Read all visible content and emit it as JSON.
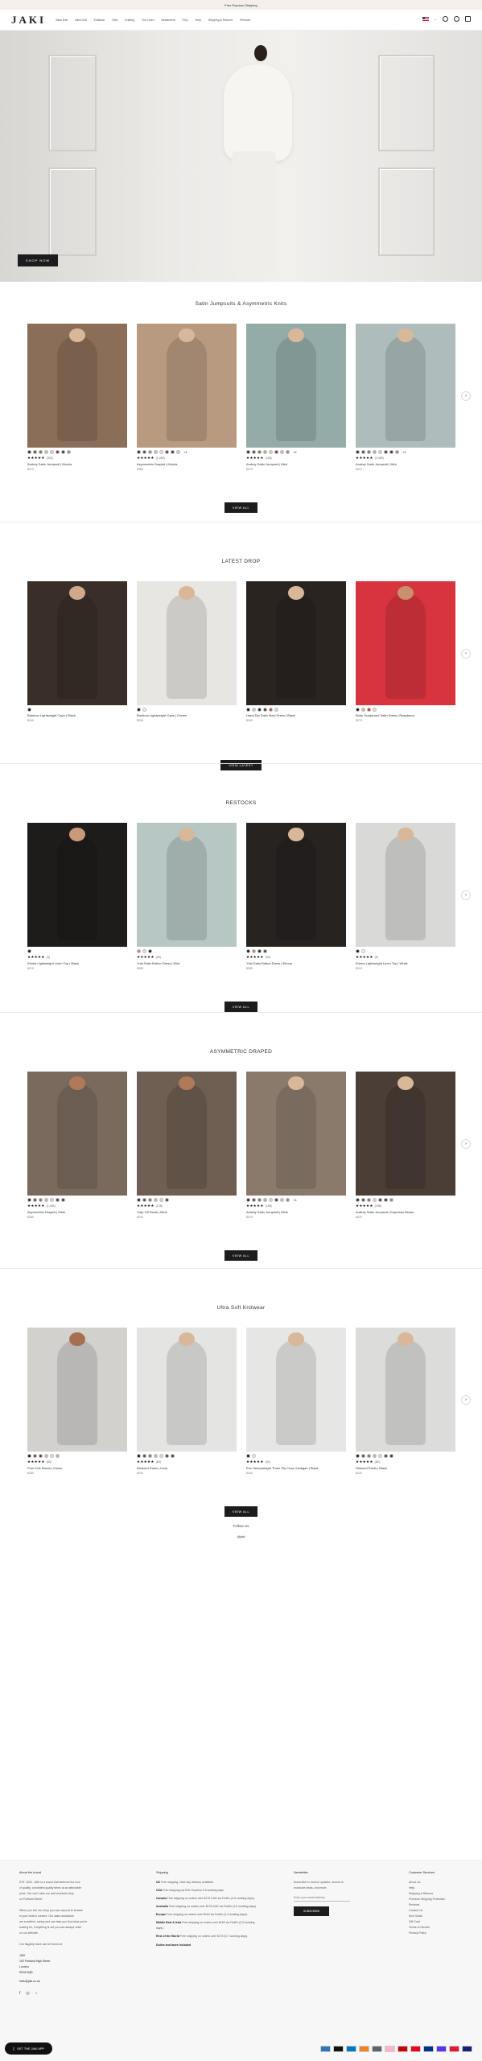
{
  "announcement": "Free Express Shipping",
  "header": {
    "logo": "JAKI",
    "nav": [
      "Satin Edit",
      "Ultra Soft",
      "Knitwear",
      "Sets",
      "Knitting",
      "The Linen",
      "Bestsellers",
      "FAQ",
      "Help",
      "Shipping & Returns",
      "Reviews"
    ],
    "flag": "US",
    "icons": [
      "account-icon",
      "search-icon",
      "bag-icon"
    ]
  },
  "hero": {
    "button_label": "SHOP NOW"
  },
  "sections": [
    {
      "title": "Satin Jumpsuits & Asymmetric Knits",
      "button_label": "VIEW ALL",
      "products": [
        {
          "name": "Audrey Satin Jumpsuit | Mocha",
          "price": "$379",
          "stars": "★★★★★",
          "reviews": "(332)",
          "swatches": [
            "#2b2b2b",
            "#6b4a3a",
            "#8a6f5c",
            "#c9b7a3",
            "#ddd2c4",
            "#7b2a3b",
            "#3a3a3a",
            "#9a8a7a"
          ],
          "more": "",
          "img": "#8a6e58",
          "skin": "#d9b89a"
        },
        {
          "name": "Asymmetric Draped | Mocha",
          "price": "$385",
          "stars": "★★★★★",
          "reviews": "(1,469)",
          "swatches": [
            "#2b2b2b",
            "#6b4a3a",
            "#a58f7b",
            "#c9c3bb",
            "#e6e0d6",
            "#7b2a3b",
            "#3a3a3a",
            "#d4c9bb"
          ],
          "more": "+4",
          "img": "#b89a80",
          "skin": "#d9b89a"
        },
        {
          "name": "Audrey Satin Jumpsuit | Mint",
          "price": "$379",
          "stars": "★★★★★",
          "reviews": "(158)",
          "swatches": [
            "#2b2b2b",
            "#6b4a3a",
            "#8a6f5c",
            "#9bb3ad",
            "#ddd2c4",
            "#7b2a3b",
            "#c3c3c3",
            "#9a8a7a"
          ],
          "more": "+4",
          "img": "#93aca8",
          "skin": "#d9b89a"
        },
        {
          "name": "Audrey Satin Jumpsuit | Mint",
          "price": "$379",
          "stars": "★★★★★",
          "reviews": "(1,469)",
          "swatches": [
            "#2b2b2b",
            "#6b4a3a",
            "#8a6f5c",
            "#9bb3ad",
            "#ddd2c4",
            "#7b2a3b",
            "#3a3a3a",
            "#9a8a7a"
          ],
          "more": "+4",
          "img": "#aebcbc",
          "skin": "#d9b89a"
        }
      ]
    },
    {
      "title": "LATEST DROP",
      "button_label": "VIEW LATEST",
      "products": [
        {
          "name": "Bamboo Lightweight Cape | Black",
          "price": "$249",
          "stars": "",
          "reviews": "",
          "swatches": [
            "#1a1a1a"
          ],
          "more": "",
          "img": "#3a2e28",
          "skin": "#d0a98d"
        },
        {
          "name": "Bamboo Lightweight Cape | Cream",
          "price": "$249",
          "stars": "",
          "reviews": "",
          "swatches": [
            "#1a1a1a",
            "#f2efe9"
          ],
          "more": "",
          "img": "#e8e6e2",
          "skin": "#d9b89a"
        },
        {
          "name": "Hand Dip Satin Maxi Dress | Black",
          "price": "$299",
          "stars": "",
          "reviews": "",
          "swatches": [
            "#1a1a1a",
            "#e3c8b8",
            "#2a2a2a",
            "#5a3a30",
            "#c14b4b",
            "#d9d2c6"
          ],
          "more": "",
          "img": "#2a2421",
          "skin": "#d9b89a"
        },
        {
          "name": "Body Sculptured Satin Dress | Raspberry",
          "price": "$279",
          "stars": "",
          "reviews": "",
          "swatches": [
            "#1a1a1a",
            "#c9b8a8",
            "#c9323f",
            "#e8ddd2"
          ],
          "more": "",
          "img": "#d7343d",
          "skin": "#c98f6f"
        }
      ]
    },
    {
      "title": "RESTOCKS",
      "button_label": "VIEW ALL",
      "products": [
        {
          "name": "Kimba Lightweight Linen Top | Black",
          "price": "$219",
          "stars": "★★★★★",
          "reviews": "(9)",
          "swatches": [
            "#1a1a1a"
          ],
          "more": "",
          "img": "#1e1c1b",
          "skin": "#c89a7a"
        },
        {
          "name": "Yula Satin Button Dress | Mint",
          "price": "$289",
          "stars": "★★★★★",
          "reviews": "(53)",
          "swatches": [
            "#c9856a",
            "#e5dccf",
            "#1a1a1a"
          ],
          "more": "",
          "img": "#b7c7c3",
          "skin": "#d9b89a"
        },
        {
          "name": "Yula Satin Button Dress | Ebony",
          "price": "$289",
          "stars": "★★★★★",
          "reviews": "(53)",
          "swatches": [
            "#1a1a1a",
            "#c9856a",
            "#2a2a2a",
            "#4a4a4a"
          ],
          "more": "",
          "img": "#262321",
          "skin": "#d9b89a"
        },
        {
          "name": "Emma Lightweight Linen Top | White",
          "price": "$219",
          "stars": "★★★★★",
          "reviews": "(9)",
          "swatches": [
            "#1a1a1a",
            "#f5f5f2"
          ],
          "more": "",
          "img": "#d9d9d7",
          "skin": "#d9b89a"
        }
      ]
    },
    {
      "title": "ASYMMETRIC DRAPED",
      "button_label": "VIEW ALL",
      "products": [
        {
          "name": "Asymmetric Draped | Mink",
          "price": "$385",
          "stars": "★★★★★",
          "reviews": "(1,469)",
          "swatches": [
            "#2b2b2b",
            "#6b4a3a",
            "#8a7566",
            "#c9b7a3",
            "#ddd2c4",
            "#7b2a3b",
            "#3a3a3a"
          ],
          "more": "",
          "img": "#7a6a5e",
          "skin": "#b07a5a"
        },
        {
          "name": "Tulip Oil Pants | Mink",
          "price": "$249",
          "stars": "★★★★★",
          "reviews": "(128)",
          "swatches": [
            "#2b2b2b",
            "#6b4a3a",
            "#8a7566",
            "#c9b7a3",
            "#ddd2c4",
            "#7b2a3b"
          ],
          "more": "",
          "img": "#6f5e52",
          "skin": "#b07a5a"
        },
        {
          "name": "Audrey Satin Jumpsuit | Mink",
          "price": "$379",
          "stars": "★★★★★",
          "reviews": "(158)",
          "swatches": [
            "#2b2b2b",
            "#6b4a3a",
            "#8a7566",
            "#9bb3ad",
            "#ddd2c4",
            "#7b2a3b",
            "#c3c3c3",
            "#9a8a7a"
          ],
          "more": "+4",
          "img": "#8a7a6c",
          "skin": "#d9b89a"
        },
        {
          "name": "Audrey Satin Jumpsuit | Espresso Brown",
          "price": "$379",
          "stars": "★★★★★",
          "reviews": "(158)",
          "swatches": [
            "#2b2b2b",
            "#6b4a3a",
            "#8a6f5c",
            "#ddd2c4",
            "#7b2a3b",
            "#3a3a3a",
            "#9a8a7a"
          ],
          "more": "",
          "img": "#4a3e36",
          "skin": "#d9b89a"
        }
      ]
    },
    {
      "title": "Ultra Soft Knitwear",
      "button_label": "VIEW ALL",
      "products": [
        {
          "name": "Pure Knit Sweat | Cerise",
          "price": "$289",
          "stars": "★★★★★",
          "reviews": "(80)",
          "swatches": [
            "#1a1a1a",
            "#6b4a3a",
            "#7a2a55",
            "#c9b7a3",
            "#e3ddd2",
            "#b2b2b2"
          ],
          "more": "",
          "img": "#d3d1ce",
          "skin": "#a56f50"
        },
        {
          "name": "Relaxed Pants | Ivory",
          "price": "$249",
          "stars": "★★★★★",
          "reviews": "(80)",
          "swatches": [
            "#1a1a1a",
            "#6b4a3a",
            "#8a7566",
            "#c9b7a3",
            "#e3ddd2",
            "#7b2a3b",
            "#2f3a5a"
          ],
          "more": "",
          "img": "#e4e4e2",
          "skin": "#d9b89a"
        },
        {
          "name": "Eve Heavyweight Three Ply Cozy Cardigan | Black",
          "price": "$349",
          "stars": "★★★★★",
          "reviews": "(52)",
          "swatches": [
            "#1a1a1a",
            "#f3f0ea"
          ],
          "more": "",
          "img": "#e6e6e4",
          "skin": "#d9b89a"
        },
        {
          "name": "Relaxed Pants | Black",
          "price": "$249",
          "stars": "★★★★★",
          "reviews": "(80)",
          "swatches": [
            "#1a1a1a",
            "#6b4a3a",
            "#8a7566",
            "#c9b7a3",
            "#e3ddd2",
            "#7b2a3b",
            "#2f3a5a"
          ],
          "more": "",
          "img": "#dcdcda",
          "skin": "#d9b89a"
        }
      ]
    }
  ],
  "follow": {
    "title": "Follow Us",
    "handle": "@jaki"
  },
  "footer": {
    "about": {
      "title": "About the brand",
      "lines": [
        "EST. 2020. JAKI is a brand that believes the love",
        "of quality, consistent quality items at an affordable",
        "price. You can't miss our well-received shop",
        "on Portland Street."
      ],
      "lines2": [
        "When you see our shop you can request to browse",
        "in your heart's content. Our sales assistants",
        "are excellent, caring and can help you find what you're",
        "looking for, if anything is out you can always order",
        "on our website."
      ],
      "lines3": [
        "Our flagship store can be found at:"
      ],
      "address": [
        "JAKI",
        "192 Portland High Street",
        "London",
        "W1W 5QB"
      ],
      "email": "hello@jaki.co.uk",
      "social": [
        "f",
        "◎",
        "♪"
      ]
    },
    "shipping": {
      "title": "Shipping",
      "rows": [
        {
          "label": "UK",
          "text": "Free shipping. Next day delivery available."
        },
        {
          "label": "USA",
          "text": "Free shipping via DHL Express 3-5 working days."
        },
        {
          "label": "Canada",
          "text": "Free shipping on orders over $175 CAD via FedEx (3-5 working days)."
        },
        {
          "label": "Australia",
          "text": "Free shipping on orders over $175 AUD via FedEx (3-5 working days)."
        },
        {
          "label": "Europe",
          "text": "Free shipping on orders over €150 via FedEx (2-4 working days)."
        },
        {
          "label": "Middle East & Asia",
          "text": "Free shipping on orders over $150 via FedEx (3-5 working days)."
        },
        {
          "label": "Rest of the World",
          "text": "Free shipping on orders over $175 (5-7 working days)."
        }
      ],
      "note": "Duties and taxes included"
    },
    "newsletter": {
      "title": "Newsletter",
      "text": [
        "Subscribe to receive updates, access to",
        "exclusive deals, and more."
      ],
      "placeholder": "Enter your email address",
      "button": "SUBSCRIBE"
    },
    "links": {
      "title": "Customer Services",
      "items": [
        "About Us",
        "Help",
        "Shipping & Returns",
        "Premium Shipping Protection",
        "Reviews",
        "Contact Us",
        "Size Guide",
        "Gift Card",
        "Terms of Service",
        "Privacy Policy"
      ]
    }
  },
  "app_button": "GET THE JAKI APP",
  "payments": [
    {
      "name": "Amex",
      "color": "#2e77bc"
    },
    {
      "name": "Apple Pay",
      "color": "#111111"
    },
    {
      "name": "Diners",
      "color": "#0079be"
    },
    {
      "name": "Discover",
      "color": "#f58220"
    },
    {
      "name": "G Pay",
      "color": "#5f6368"
    },
    {
      "name": "Klarna",
      "color": "#ffb3c7"
    },
    {
      "name": "Maestro",
      "color": "#cc0000"
    },
    {
      "name": "MC",
      "color": "#eb001b"
    },
    {
      "name": "PayPal",
      "color": "#003087"
    },
    {
      "name": "Shop Pay",
      "color": "#5a31f4"
    },
    {
      "name": "Union Pay",
      "color": "#e21836"
    },
    {
      "name": "Visa",
      "color": "#1a1f71"
    }
  ]
}
